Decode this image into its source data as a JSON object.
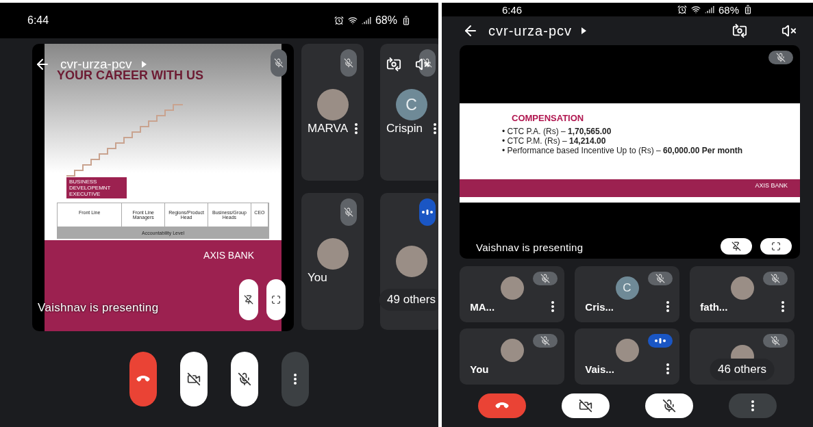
{
  "screens": [
    {
      "kind": "split",
      "status_bar": {
        "time": "6:44",
        "battery": "68%"
      },
      "meeting_title": "cvr-urza-pcv",
      "presentation": {
        "caption": "Vaishnav is presenting",
        "slide": {
          "kind": "career",
          "title": "YOUR CAREER WITH US",
          "badge": "BUSINESS DEVELOPEMNT EXECUTIVE",
          "columns": [
            "Front Line",
            "Front Line Managers",
            "Regions/Product Head",
            "Business/Group Heads",
            "CEO"
          ],
          "footer": "Accountability Level",
          "brand": "AXIS BANK"
        }
      },
      "participants": [
        {
          "kind": "person",
          "name": "MARVA",
          "photo": true,
          "muted": true,
          "menu": true
        },
        {
          "kind": "person",
          "name": "Crispin",
          "photo": false,
          "initial": "C",
          "muted": true,
          "menu": true
        },
        {
          "kind": "person",
          "name": "You",
          "photo": true,
          "muted": true,
          "menu": false
        },
        {
          "kind": "others",
          "label": "49 others",
          "photo": true,
          "muted": false
        }
      ],
      "controls": [
        {
          "kind": "end-call"
        },
        {
          "kind": "camera",
          "on": false
        },
        {
          "kind": "mic",
          "on": false
        },
        {
          "kind": "more"
        }
      ]
    },
    {
      "kind": "grid",
      "status_bar": {
        "time": "6:46",
        "battery": "68%"
      },
      "meeting_title": "cvr-urza-pcv",
      "presentation": {
        "caption": "Vaishnav is presenting",
        "slide": {
          "kind": "compensation",
          "title": "COMPENSATION",
          "bullets": [
            "• CTC P.A. (Rs) – **1,70,565.00**",
            "• CTC P.M. (Rs) – **14,214.00**",
            "• Performance based Incentive Up to (Rs) – **60,000.00 Per month**"
          ],
          "brand": "AXIS BANK"
        }
      },
      "participants": [
        {
          "kind": "person",
          "name": "MA...",
          "photo": true,
          "muted": true,
          "menu": true
        },
        {
          "kind": "person",
          "name": "Cris...",
          "photo": false,
          "initial": "C",
          "muted": true,
          "menu": true
        },
        {
          "kind": "person",
          "name": "fath...",
          "photo": true,
          "muted": true,
          "menu": true
        },
        {
          "kind": "person",
          "name": "You",
          "photo": true,
          "muted": true,
          "menu": false
        },
        {
          "kind": "person",
          "name": "Vais...",
          "photo": true,
          "muted": false,
          "menu": true
        },
        {
          "kind": "others",
          "label": "46 others",
          "photo": true,
          "muted": true
        }
      ],
      "controls": [
        {
          "kind": "end-call"
        },
        {
          "kind": "camera",
          "on": false
        },
        {
          "kind": "mic",
          "on": false
        },
        {
          "kind": "more"
        }
      ]
    }
  ]
}
